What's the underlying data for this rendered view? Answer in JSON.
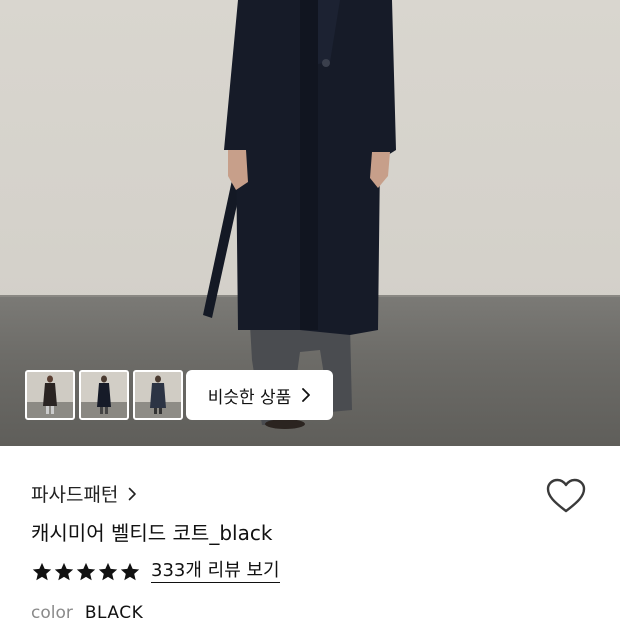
{
  "gallery": {
    "thumbnails": [
      "thumbnail-1",
      "thumbnail-2",
      "thumbnail-3"
    ],
    "similar_button_label": "비슷한 상품"
  },
  "product": {
    "brand": "파사드패턴",
    "title": "캐시미어 벨티드 코트_black",
    "rating_stars": 5,
    "review_link_label": "333개 리뷰 보기",
    "color_label": "color",
    "color_value": "BLACK"
  },
  "icons": {
    "brand_chevron": "chevron-right-icon",
    "similar_chevron": "chevron-right-icon",
    "wishlist": "heart-outline-icon",
    "star": "star-filled-icon"
  },
  "colors": {
    "coat": "#151a26",
    "background_wall": "#d6d3cc",
    "floor": "#6b6a66",
    "text": "#111111",
    "muted": "#8a8a8a"
  }
}
